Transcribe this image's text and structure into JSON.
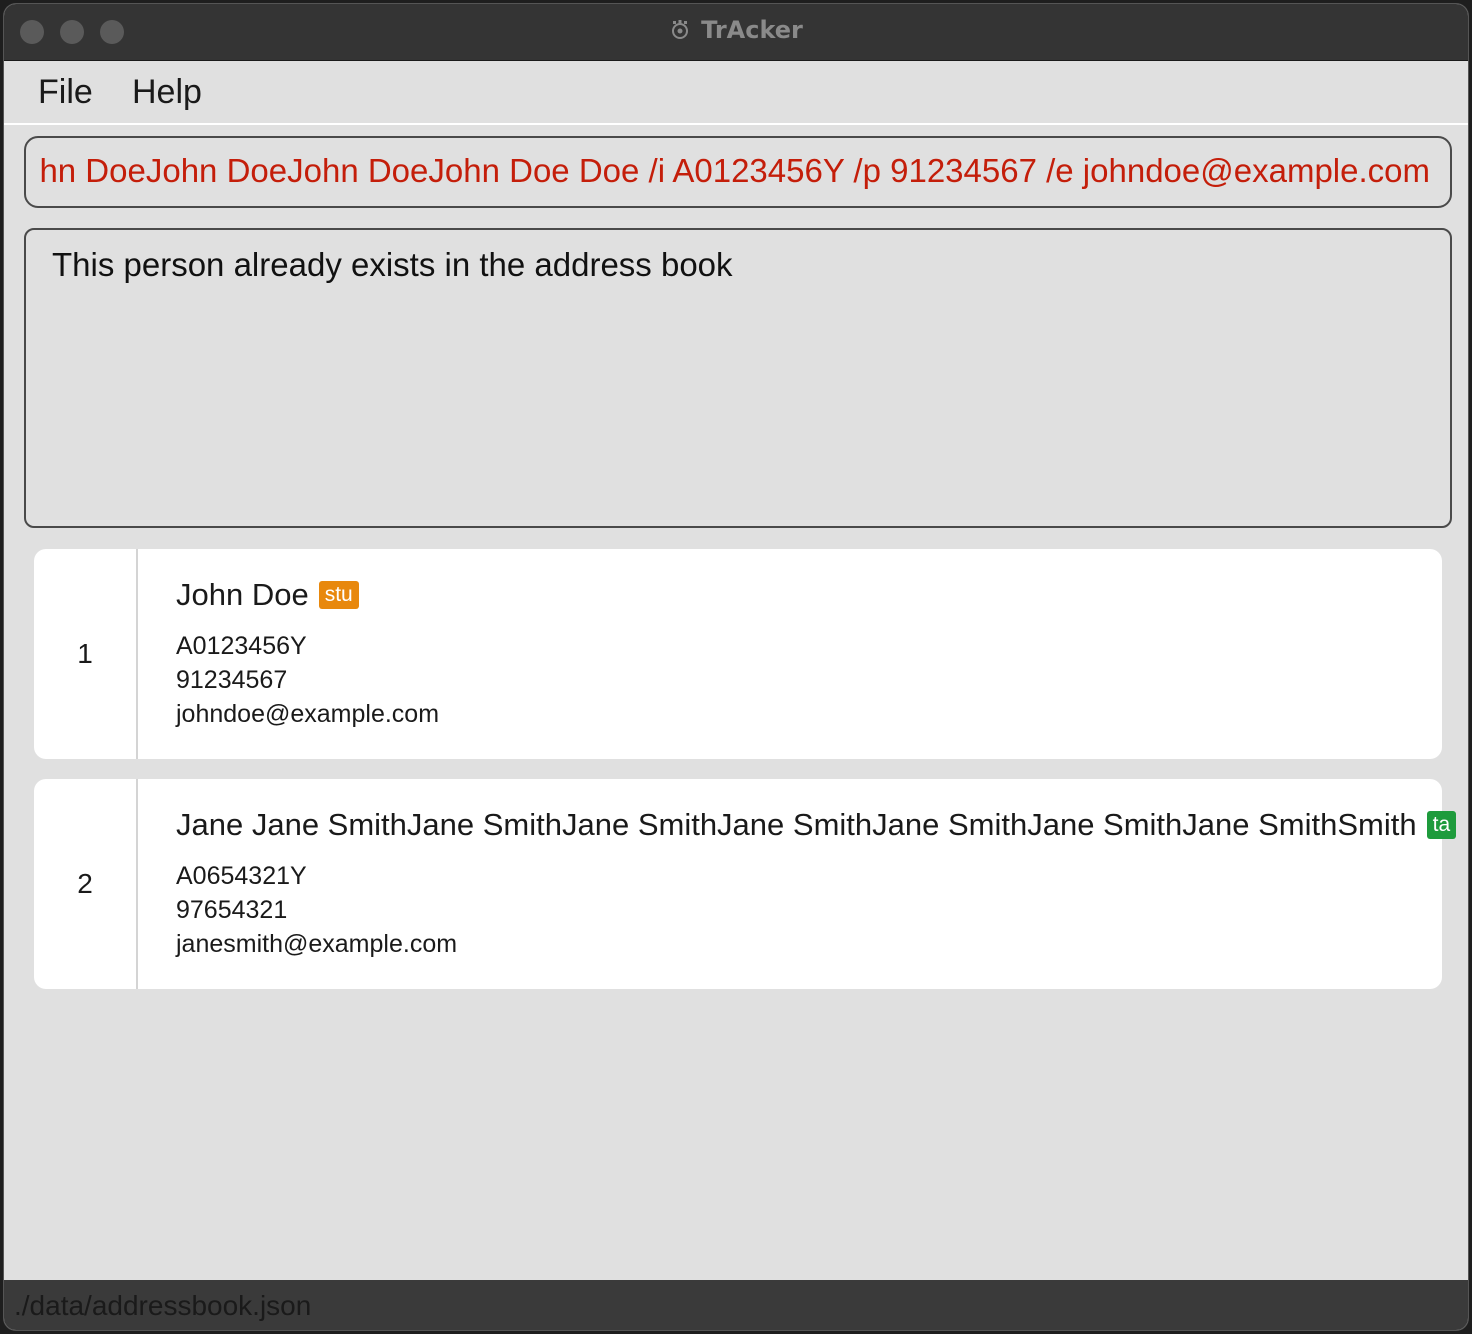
{
  "window": {
    "title": "TrAcker"
  },
  "menu": {
    "file": "File",
    "help": "Help"
  },
  "command_box": {
    "value": "hn DoeJohn DoeJohn DoeJohn Doe Doe /i A0123456Y /p 91234567 /e johndoe@example.com"
  },
  "result": {
    "message": "This person already exists in the address book"
  },
  "persons": [
    {
      "index": "1",
      "name": "John Doe",
      "tag": "stu",
      "id": "A0123456Y",
      "phone": "91234567",
      "email": "johndoe@example.com"
    },
    {
      "index": "2",
      "name": "Jane Jane SmithJane SmithJane SmithJane SmithJane SmithJane SmithJane SmithSmith",
      "tag": "ta",
      "id": "A0654321Y",
      "phone": "97654321",
      "email": "janesmith@example.com"
    }
  ],
  "status_bar": {
    "path": "./data/addressbook.json"
  },
  "colors": {
    "error_text": "#c41e0a",
    "tag_stu": "#e8880d",
    "tag_ta": "#1e9b3c"
  }
}
